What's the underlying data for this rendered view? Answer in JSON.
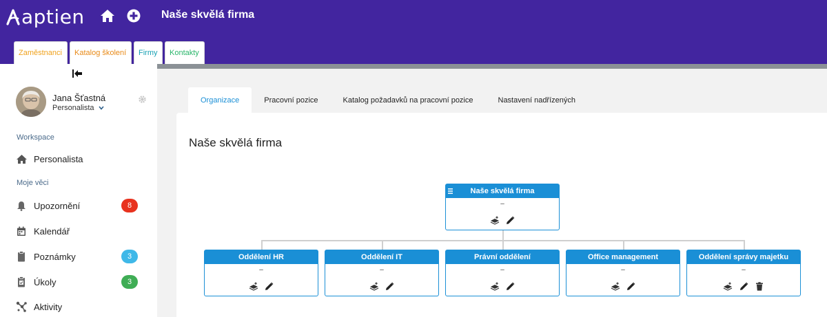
{
  "app": {
    "logo_text": "aptien",
    "company_title": "Naše skvělá firma"
  },
  "header": {
    "icons": [
      "home-icon",
      "plus-circle-icon"
    ]
  },
  "app_tabs": [
    {
      "label": "Zaměstnanci",
      "color": "#f0a21c"
    },
    {
      "label": "Katalog školení",
      "color": "#e88a18"
    },
    {
      "label": "Firmy",
      "color": "#17a0b3"
    },
    {
      "label": "Kontakty",
      "color": "#29b56a"
    }
  ],
  "user": {
    "name": "Jana Šťastná",
    "role": "Personalista"
  },
  "sidebar": {
    "workspace_label": "Workspace",
    "workspace_item": "Personalista",
    "my_things_label": "Moje věci",
    "items": [
      {
        "label": "Upozornění",
        "icon": "bell-icon",
        "badge": "8",
        "badge_color": "#e8321e"
      },
      {
        "label": "Kalendář",
        "icon": "calendar-icon"
      },
      {
        "label": "Poznámky",
        "icon": "clipboard-icon",
        "badge": "3",
        "badge_color": "#3fb8e8"
      },
      {
        "label": "Úkoly",
        "icon": "task-clipboard-icon",
        "badge": "3",
        "badge_color": "#3fad55"
      },
      {
        "label": "Aktivity",
        "icon": "activity-icon"
      }
    ]
  },
  "main": {
    "tabs": [
      {
        "label": "Organizace",
        "active": true
      },
      {
        "label": "Pracovní pozice"
      },
      {
        "label": "Katalog požadavků na pracovní pozice"
      },
      {
        "label": "Nastavení nadřízených"
      }
    ],
    "title": "Naše skvělá firma"
  },
  "org_chart": {
    "root": {
      "name": "Naše skvělá firma",
      "dash": "–"
    },
    "children": [
      {
        "name": "Oddělení HR",
        "dash": "–"
      },
      {
        "name": "Oddělení IT",
        "dash": "–"
      },
      {
        "name": "Právní oddělení",
        "dash": "–"
      },
      {
        "name": "Office management",
        "dash": "–"
      },
      {
        "name": "Oddělení správy majetku",
        "dash": "–",
        "deletable": true
      }
    ]
  },
  "colors": {
    "header_bg": "#42259f",
    "accent": "#1a8fd6"
  }
}
